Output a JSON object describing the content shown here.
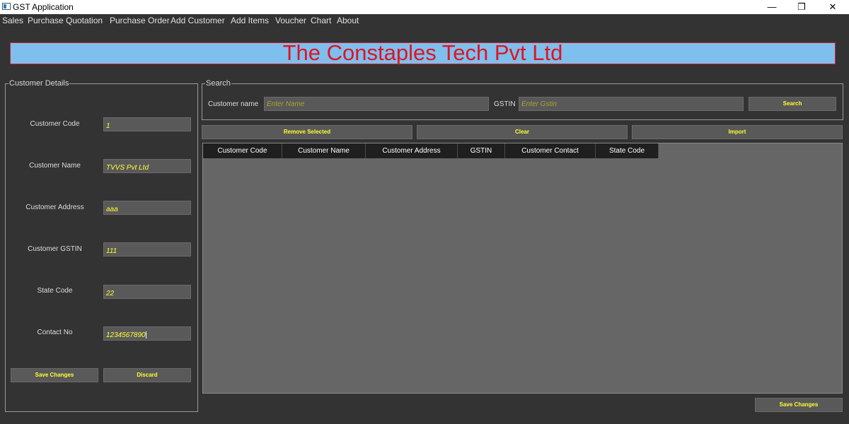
{
  "window": {
    "title": "GST Application",
    "minimize": "—",
    "maximize": "❐",
    "close": "✕"
  },
  "menu": [
    "Sales",
    "Purchase",
    "Quotation",
    "Purchase Order",
    "Add Customer",
    "Add Items",
    "Voucher",
    "Chart",
    "About"
  ],
  "banner": {
    "text": "The Constaples Tech Pvt Ltd"
  },
  "customer_details": {
    "title": "Customer Details",
    "fields": [
      {
        "label": "Customer Code",
        "value": "1"
      },
      {
        "label": "Customer Name",
        "value": "TVVS Pvt Ltd"
      },
      {
        "label": "Customer Address",
        "value": "aaa"
      },
      {
        "label": "Customer GSTIN",
        "value": "111"
      },
      {
        "label": "State Code",
        "value": "22"
      },
      {
        "label": "Contact No",
        "value": "1234567890"
      }
    ],
    "save_label": "Save Changes",
    "discard_label": "Discard"
  },
  "search": {
    "title": "Search",
    "name_label": "Customer name",
    "name_placeholder": "Enter Name",
    "gstin_label": "GSTIN",
    "gstin_placeholder": "Enter Gstin",
    "button": "Search"
  },
  "actions": {
    "remove": "Remove Selected",
    "clear": "Clear",
    "import": "Import"
  },
  "table": {
    "columns": [
      "Customer Code",
      "Customer Name",
      "Customer Address",
      "GSTIN",
      "Customer Contact",
      "State Code"
    ],
    "rows": []
  },
  "footer": {
    "save_label": "Save Changes"
  },
  "colors": {
    "background": "#333333",
    "banner_bg": "#7fbfee",
    "banner_text": "#e0141f",
    "input_text": "#ffff33"
  }
}
